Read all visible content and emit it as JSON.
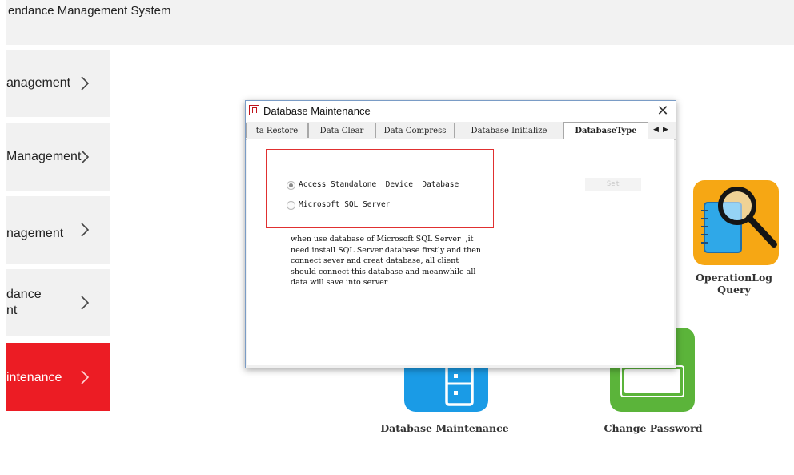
{
  "app": {
    "title": "endance Management System"
  },
  "sidebar": {
    "items": [
      {
        "label": "anagement",
        "active": false
      },
      {
        "label": "Management",
        "active": false
      },
      {
        "label": "nagement",
        "active": false
      },
      {
        "label": "dance\nnt",
        "active": false
      },
      {
        "label": "intenance",
        "active": true
      }
    ]
  },
  "tiles": {
    "operation_log": {
      "label_line1": "OperationLog",
      "label_line2": "Query",
      "color": "#f6a714"
    },
    "database_maintenance": {
      "label": "Database Maintenance",
      "color": "#1a9be6"
    },
    "change_password": {
      "label": "Change Password",
      "color": "#5bb43a",
      "mask": "***"
    }
  },
  "dialog": {
    "title": "Database Maintenance",
    "close_glyph": "✕",
    "tabs": [
      {
        "label": "ta Restore",
        "active": false
      },
      {
        "label": "Data Clear",
        "active": false
      },
      {
        "label": "Data Compress",
        "active": false
      },
      {
        "label": "Database Initialize",
        "active": false
      },
      {
        "label": "DatabaseType",
        "active": true
      }
    ],
    "scroll_left": "◀",
    "scroll_right": "▶",
    "options": [
      {
        "label": "Access Standalone  Device  Database",
        "selected": true
      },
      {
        "label": "Microsoft SQL Server",
        "selected": false
      }
    ],
    "set_button": "Set",
    "note_lines": [
      "when use database of Microsoft SQL Server  ,it",
      "need install SQL Server database firstly and then",
      "connect sever and creat database, all client",
      "should connect this database and meanwhile all",
      "data will save into server"
    ]
  },
  "colors": {
    "accent": "#ec1c24",
    "highlight_box": "#e03030"
  }
}
